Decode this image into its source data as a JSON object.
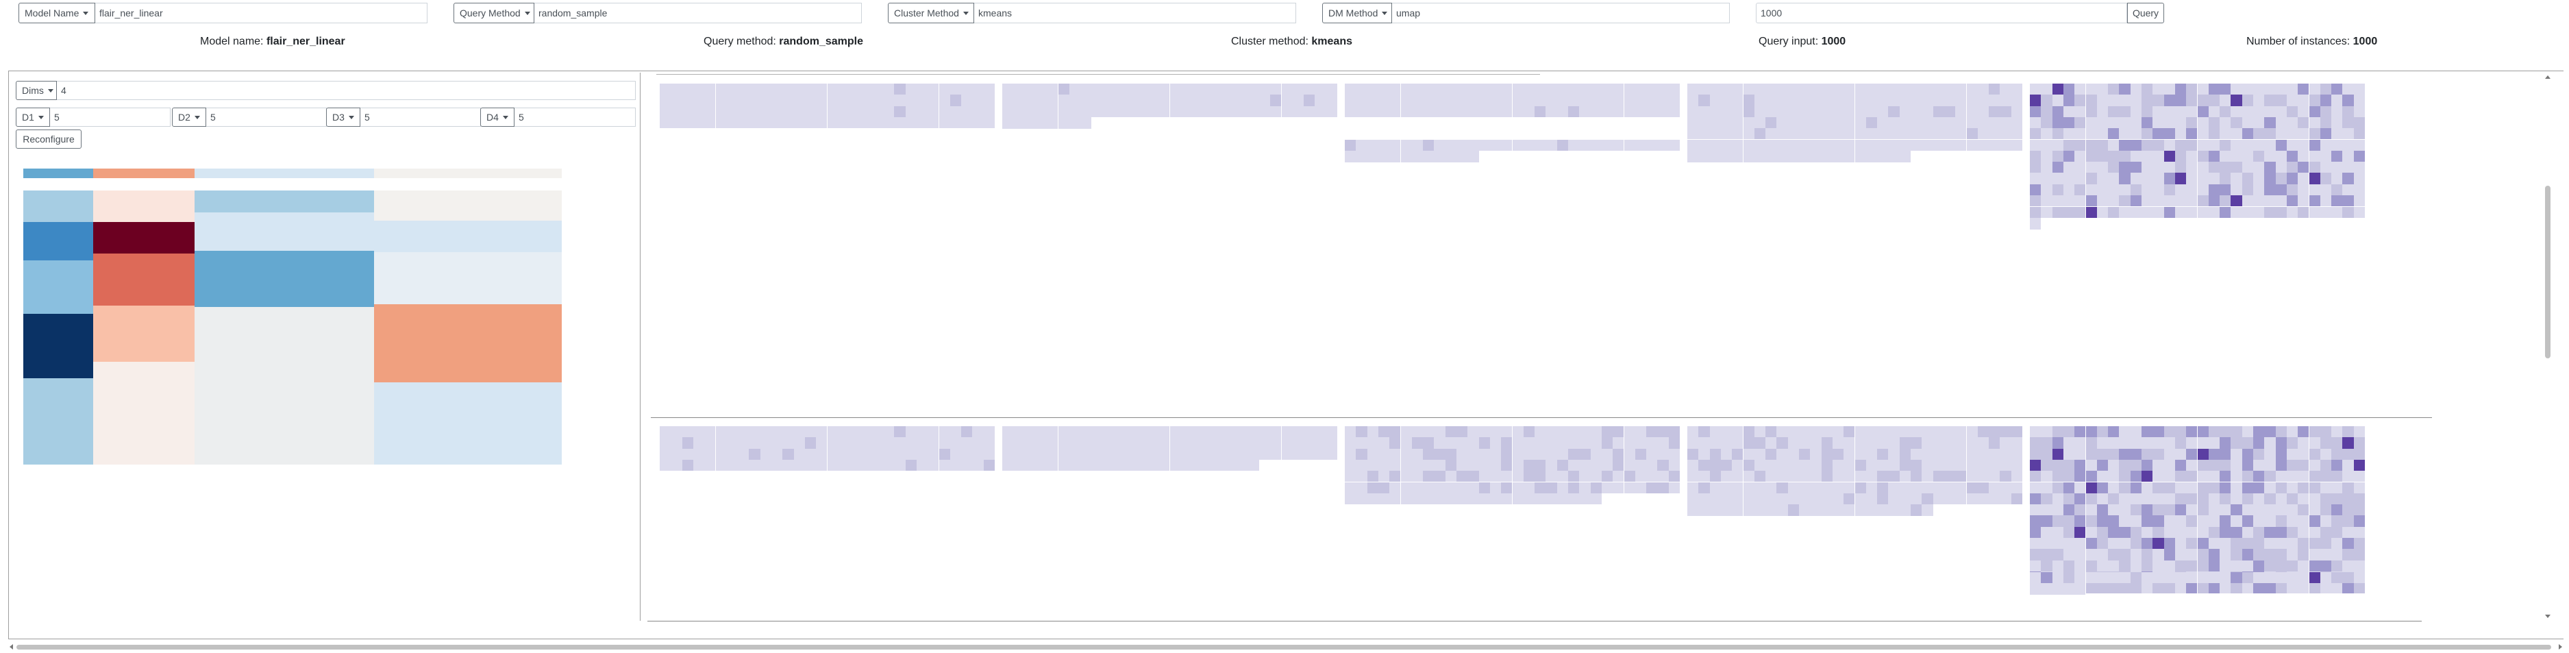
{
  "toolbar": {
    "model_name_label": "Model Name",
    "model_name_value": "flair_ner_linear",
    "query_method_label": "Query Method",
    "query_method_value": "random_sample",
    "cluster_method_label": "Cluster Method",
    "cluster_method_value": "kmeans",
    "dm_method_label": "DM Method",
    "dm_method_value": "umap",
    "query_input_value": "1000",
    "query_button": "Query"
  },
  "info": {
    "model_label": "Model name:",
    "model_value": "flair_ner_linear",
    "query_method_label": "Query method:",
    "query_method_value": "random_sample",
    "cluster_method_label": "Cluster method:",
    "cluster_method_value": "kmeans",
    "query_input_label": "Query input:",
    "query_input_value": "1000",
    "instances_label": "Number of instances:",
    "instances_value": "1000"
  },
  "config": {
    "dims_label": "Dims",
    "dims_value": "4",
    "d1_label": "D1",
    "d1_value": "5",
    "d2_label": "D2",
    "d2_value": "5",
    "d3_label": "D3",
    "d3_value": "5",
    "d4_label": "D4",
    "d4_value": "5",
    "reconfigure_button": "Reconfigure"
  },
  "colors": {
    "blue_scale": [
      "#d6e6f3",
      "#a6cde3",
      "#8abfdf",
      "#64a8d0",
      "#3d88c4",
      "#0a3265"
    ],
    "red_scale": [
      "#f7eeea",
      "#fae5dd",
      "#f9c0a8",
      "#f0a07f",
      "#dd6a58",
      "#6c0021"
    ],
    "neutral": "#f3f1ee",
    "grid_base": "#dcdbed",
    "grid_mid": "#c5c3e0",
    "grid_dark": "#9e99ce",
    "grid_darkest": "#5b3ea2"
  }
}
